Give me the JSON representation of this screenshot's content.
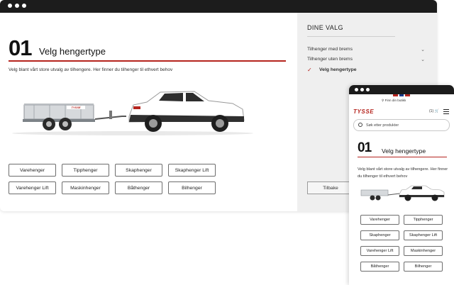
{
  "desktop": {
    "step_number": "01",
    "step_title": "Velg hengertype",
    "intro": "Velg blant vårt store utvalg av tilhengere. Her finner du tilhenger til ethvert behov",
    "trailer_brand": "TYSSE",
    "types": [
      "Varehenger",
      "Tipphenger",
      "Skaphenger",
      "Skaphenger Lift",
      "Varehenger Lift",
      "Maskinhenger",
      "Båthenger",
      "Bilhenger"
    ]
  },
  "sidebar": {
    "title": "DINE VALG",
    "items": [
      {
        "label": "Tilhenger med brems",
        "icon": "chevron-down-icon"
      },
      {
        "label": "Tilhenger uten brems",
        "icon": "chevron-down-icon"
      },
      {
        "label": "Velg hengertype",
        "icon": "checkmark-icon"
      }
    ],
    "back_label": "Tilbake"
  },
  "mobile": {
    "find_store": "Finn din butikk",
    "logo": "TYSSE",
    "cart_count": "(1)",
    "search_placeholder": "Søk etter produkter",
    "step_number": "01",
    "step_title": "Velg hengertype",
    "intro": "Velg blant vårt store utvalg av tilhengere. Her finner du tilhenger til ethvert behov",
    "types": [
      "Varehenger",
      "Tipphenger",
      "Skaphenger",
      "Skaphenger Lift",
      "Varehenger Lift",
      "Maskinhenger",
      "Båthenger",
      "Bilhenger"
    ]
  },
  "colors": {
    "accent_red": "#b5241e",
    "titlebar": "#1c1c1c",
    "sidebar_bg": "#efefef"
  }
}
